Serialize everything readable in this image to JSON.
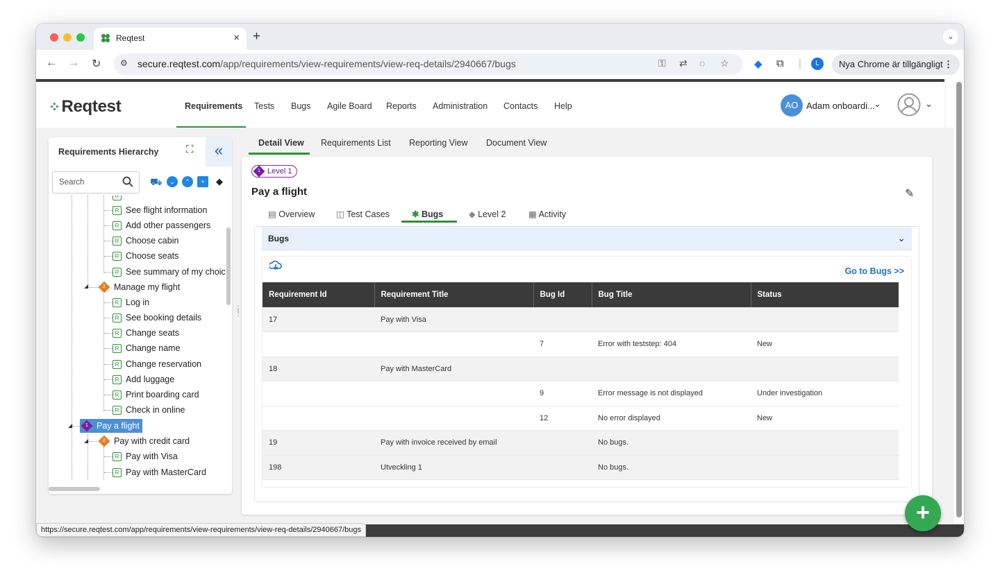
{
  "browser": {
    "tab_title": "Reqtest",
    "url_domain": "secure.reqtest.com",
    "url_path": "/app/requirements/view-requirements/view-req-details/2940667/bugs",
    "profile_initial": "L",
    "update_label": "Nya Chrome är tillgängligt",
    "status_url": "https://secure.reqtest.com/app/requirements/view-requirements/view-req-details/2940667/bugs"
  },
  "app": {
    "logo": "Reqtest",
    "nav": [
      "Requirements",
      "Tests",
      "Bugs",
      "Agile Board",
      "Reports",
      "Administration",
      "Contacts",
      "Help"
    ],
    "user_initials": "AO",
    "user_name": "Adam onboardi..."
  },
  "hierarchy": {
    "title": "Requirements Hierarchy",
    "search_placeholder": "Search",
    "items": [
      {
        "label": "See flight information",
        "type": "R"
      },
      {
        "label": "Add other passengers",
        "type": "R"
      },
      {
        "label": "Choose cabin",
        "type": "R"
      },
      {
        "label": "Choose seats",
        "type": "R"
      },
      {
        "label": "See summary of my choic",
        "type": "R"
      },
      {
        "label": "Manage my flight",
        "type": "2"
      },
      {
        "label": "Log in",
        "type": "R"
      },
      {
        "label": "See booking details",
        "type": "R"
      },
      {
        "label": "Change seats",
        "type": "R"
      },
      {
        "label": "Change name",
        "type": "R"
      },
      {
        "label": "Change reservation",
        "type": "R"
      },
      {
        "label": "Add luggage",
        "type": "R"
      },
      {
        "label": "Print boarding card",
        "type": "R"
      },
      {
        "label": "Check in online",
        "type": "R"
      },
      {
        "label": "Pay a flight",
        "type": "1"
      },
      {
        "label": "Pay with credit card",
        "type": "2"
      },
      {
        "label": "Pay with Visa",
        "type": "R"
      },
      {
        "label": "Pay with MasterCard",
        "type": "R"
      }
    ]
  },
  "view_tabs": [
    "Detail View",
    "Requirements List",
    "Reporting View",
    "Document View"
  ],
  "detail": {
    "level_badge": "Level 1",
    "level_number": "1",
    "title": "Pay a flight",
    "subtabs": [
      "Overview",
      "Test Cases",
      "Bugs",
      "Level 2",
      "Activity"
    ]
  },
  "bugs_panel": {
    "title": "Bugs",
    "goto_label": "Go to Bugs >>",
    "columns": [
      "Requirement Id",
      "Requirement  Title",
      "Bug Id",
      "Bug Title",
      "Status"
    ],
    "rows": [
      [
        "17",
        "Pay with Visa",
        "",
        "",
        ""
      ],
      [
        "",
        "",
        "7",
        "Error with teststep: 404",
        "New"
      ],
      [
        "18",
        "Pay with MasterCard",
        "",
        "",
        ""
      ],
      [
        "",
        "",
        "9",
        "Error message is not displayed",
        "Under investigation"
      ],
      [
        "",
        "",
        "12",
        "No error displayed",
        "New"
      ],
      [
        "19",
        "Pay with invoice received by email",
        "",
        "No bugs.",
        ""
      ],
      [
        "198",
        "Utveckling 1",
        "",
        "No bugs.",
        ""
      ]
    ]
  },
  "colors": {
    "accent_green": "#2f8f3a",
    "link_blue": "#1e73be",
    "level1_purple": "#7b1fa2",
    "level2_orange": "#e67e22",
    "table_header": "#3a3a3a"
  }
}
